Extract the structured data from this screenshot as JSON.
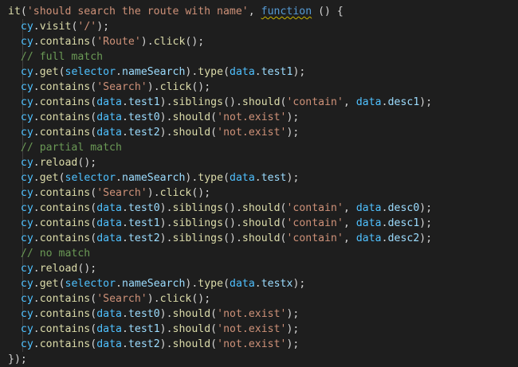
{
  "editor": {
    "theme": {
      "background": "#1e1e1e",
      "plain": "#d4d4d4",
      "variable": "#4fc1ff",
      "property": "#9cdcfe",
      "function": "#dcdcaa",
      "string": "#ce9178",
      "keyword": "#569cd6",
      "comment": "#6a9955",
      "warning_squiggle": "#c8b400"
    },
    "lines": [
      {
        "guide": false,
        "tokens": [
          [
            "fn",
            "it"
          ],
          [
            "plain",
            "("
          ],
          [
            "str",
            "'should search the route with name'"
          ],
          [
            "plain",
            ", "
          ],
          [
            "kw",
            "function",
            true
          ],
          [
            "plain",
            " () {"
          ]
        ]
      },
      {
        "guide": true,
        "tokens": [
          [
            "plain",
            "  "
          ],
          [
            "var",
            "cy"
          ],
          [
            "plain",
            "."
          ],
          [
            "fn",
            "visit"
          ],
          [
            "plain",
            "("
          ],
          [
            "str",
            "'/'"
          ],
          [
            "plain",
            ");"
          ]
        ]
      },
      {
        "guide": true,
        "tokens": [
          [
            "plain",
            "  "
          ],
          [
            "var",
            "cy"
          ],
          [
            "plain",
            "."
          ],
          [
            "fn",
            "contains"
          ],
          [
            "plain",
            "("
          ],
          [
            "str",
            "'Route'"
          ],
          [
            "plain",
            ")."
          ],
          [
            "fn",
            "click"
          ],
          [
            "plain",
            "();"
          ]
        ]
      },
      {
        "guide": true,
        "tokens": [
          [
            "plain",
            "  "
          ],
          [
            "com",
            "// full match"
          ]
        ]
      },
      {
        "guide": true,
        "tokens": [
          [
            "plain",
            "  "
          ],
          [
            "var",
            "cy"
          ],
          [
            "plain",
            "."
          ],
          [
            "fn",
            "get"
          ],
          [
            "plain",
            "("
          ],
          [
            "var",
            "selector"
          ],
          [
            "plain",
            "."
          ],
          [
            "prop",
            "nameSearch"
          ],
          [
            "plain",
            ")."
          ],
          [
            "fn",
            "type"
          ],
          [
            "plain",
            "("
          ],
          [
            "var",
            "data"
          ],
          [
            "plain",
            "."
          ],
          [
            "prop",
            "test1"
          ],
          [
            "plain",
            ");"
          ]
        ]
      },
      {
        "guide": true,
        "tokens": [
          [
            "plain",
            "  "
          ],
          [
            "var",
            "cy"
          ],
          [
            "plain",
            "."
          ],
          [
            "fn",
            "contains"
          ],
          [
            "plain",
            "("
          ],
          [
            "str",
            "'Search'"
          ],
          [
            "plain",
            ")."
          ],
          [
            "fn",
            "click"
          ],
          [
            "plain",
            "();"
          ]
        ]
      },
      {
        "guide": true,
        "tokens": [
          [
            "plain",
            "  "
          ],
          [
            "var",
            "cy"
          ],
          [
            "plain",
            "."
          ],
          [
            "fn",
            "contains"
          ],
          [
            "plain",
            "("
          ],
          [
            "var",
            "data"
          ],
          [
            "plain",
            "."
          ],
          [
            "prop",
            "test1"
          ],
          [
            "plain",
            ")."
          ],
          [
            "fn",
            "siblings"
          ],
          [
            "plain",
            "()."
          ],
          [
            "fn",
            "should"
          ],
          [
            "plain",
            "("
          ],
          [
            "str",
            "'contain'"
          ],
          [
            "plain",
            ", "
          ],
          [
            "var",
            "data"
          ],
          [
            "plain",
            "."
          ],
          [
            "prop",
            "desc1"
          ],
          [
            "plain",
            ");"
          ]
        ]
      },
      {
        "guide": true,
        "tokens": [
          [
            "plain",
            "  "
          ],
          [
            "var",
            "cy"
          ],
          [
            "plain",
            "."
          ],
          [
            "fn",
            "contains"
          ],
          [
            "plain",
            "("
          ],
          [
            "var",
            "data"
          ],
          [
            "plain",
            "."
          ],
          [
            "prop",
            "test0"
          ],
          [
            "plain",
            ")."
          ],
          [
            "fn",
            "should"
          ],
          [
            "plain",
            "("
          ],
          [
            "str",
            "'not.exist'"
          ],
          [
            "plain",
            ");"
          ]
        ]
      },
      {
        "guide": true,
        "tokens": [
          [
            "plain",
            "  "
          ],
          [
            "var",
            "cy"
          ],
          [
            "plain",
            "."
          ],
          [
            "fn",
            "contains"
          ],
          [
            "plain",
            "("
          ],
          [
            "var",
            "data"
          ],
          [
            "plain",
            "."
          ],
          [
            "prop",
            "test2"
          ],
          [
            "plain",
            ")."
          ],
          [
            "fn",
            "should"
          ],
          [
            "plain",
            "("
          ],
          [
            "str",
            "'not.exist'"
          ],
          [
            "plain",
            ");"
          ]
        ]
      },
      {
        "guide": true,
        "tokens": [
          [
            "plain",
            "  "
          ],
          [
            "com",
            "// partial match"
          ]
        ]
      },
      {
        "guide": true,
        "tokens": [
          [
            "plain",
            "  "
          ],
          [
            "var",
            "cy"
          ],
          [
            "plain",
            "."
          ],
          [
            "fn",
            "reload"
          ],
          [
            "plain",
            "();"
          ]
        ]
      },
      {
        "guide": true,
        "tokens": [
          [
            "plain",
            "  "
          ],
          [
            "var",
            "cy"
          ],
          [
            "plain",
            "."
          ],
          [
            "fn",
            "get"
          ],
          [
            "plain",
            "("
          ],
          [
            "var",
            "selector"
          ],
          [
            "plain",
            "."
          ],
          [
            "prop",
            "nameSearch"
          ],
          [
            "plain",
            ")."
          ],
          [
            "fn",
            "type"
          ],
          [
            "plain",
            "("
          ],
          [
            "var",
            "data"
          ],
          [
            "plain",
            "."
          ],
          [
            "prop",
            "test"
          ],
          [
            "plain",
            ");"
          ]
        ]
      },
      {
        "guide": true,
        "tokens": [
          [
            "plain",
            "  "
          ],
          [
            "var",
            "cy"
          ],
          [
            "plain",
            "."
          ],
          [
            "fn",
            "contains"
          ],
          [
            "plain",
            "("
          ],
          [
            "str",
            "'Search'"
          ],
          [
            "plain",
            ")."
          ],
          [
            "fn",
            "click"
          ],
          [
            "plain",
            "();"
          ]
        ]
      },
      {
        "guide": true,
        "tokens": [
          [
            "plain",
            "  "
          ],
          [
            "var",
            "cy"
          ],
          [
            "plain",
            "."
          ],
          [
            "fn",
            "contains"
          ],
          [
            "plain",
            "("
          ],
          [
            "var",
            "data"
          ],
          [
            "plain",
            "."
          ],
          [
            "prop",
            "test0"
          ],
          [
            "plain",
            ")."
          ],
          [
            "fn",
            "siblings"
          ],
          [
            "plain",
            "()."
          ],
          [
            "fn",
            "should"
          ],
          [
            "plain",
            "("
          ],
          [
            "str",
            "'contain'"
          ],
          [
            "plain",
            ", "
          ],
          [
            "var",
            "data"
          ],
          [
            "plain",
            "."
          ],
          [
            "prop",
            "desc0"
          ],
          [
            "plain",
            ");"
          ]
        ]
      },
      {
        "guide": true,
        "tokens": [
          [
            "plain",
            "  "
          ],
          [
            "var",
            "cy"
          ],
          [
            "plain",
            "."
          ],
          [
            "fn",
            "contains"
          ],
          [
            "plain",
            "("
          ],
          [
            "var",
            "data"
          ],
          [
            "plain",
            "."
          ],
          [
            "prop",
            "test1"
          ],
          [
            "plain",
            ")."
          ],
          [
            "fn",
            "siblings"
          ],
          [
            "plain",
            "()."
          ],
          [
            "fn",
            "should"
          ],
          [
            "plain",
            "("
          ],
          [
            "str",
            "'contain'"
          ],
          [
            "plain",
            ", "
          ],
          [
            "var",
            "data"
          ],
          [
            "plain",
            "."
          ],
          [
            "prop",
            "desc1"
          ],
          [
            "plain",
            ");"
          ]
        ]
      },
      {
        "guide": true,
        "tokens": [
          [
            "plain",
            "  "
          ],
          [
            "var",
            "cy"
          ],
          [
            "plain",
            "."
          ],
          [
            "fn",
            "contains"
          ],
          [
            "plain",
            "("
          ],
          [
            "var",
            "data"
          ],
          [
            "plain",
            "."
          ],
          [
            "prop",
            "test2"
          ],
          [
            "plain",
            ")."
          ],
          [
            "fn",
            "siblings"
          ],
          [
            "plain",
            "()."
          ],
          [
            "fn",
            "should"
          ],
          [
            "plain",
            "("
          ],
          [
            "str",
            "'contain'"
          ],
          [
            "plain",
            ", "
          ],
          [
            "var",
            "data"
          ],
          [
            "plain",
            "."
          ],
          [
            "prop",
            "desc2"
          ],
          [
            "plain",
            ");"
          ]
        ]
      },
      {
        "guide": true,
        "tokens": [
          [
            "plain",
            "  "
          ],
          [
            "com",
            "// no match"
          ]
        ]
      },
      {
        "guide": true,
        "tokens": [
          [
            "plain",
            "  "
          ],
          [
            "var",
            "cy"
          ],
          [
            "plain",
            "."
          ],
          [
            "fn",
            "reload"
          ],
          [
            "plain",
            "();"
          ]
        ]
      },
      {
        "guide": true,
        "tokens": [
          [
            "plain",
            "  "
          ],
          [
            "var",
            "cy"
          ],
          [
            "plain",
            "."
          ],
          [
            "fn",
            "get"
          ],
          [
            "plain",
            "("
          ],
          [
            "var",
            "selector"
          ],
          [
            "plain",
            "."
          ],
          [
            "prop",
            "nameSearch"
          ],
          [
            "plain",
            ")."
          ],
          [
            "fn",
            "type"
          ],
          [
            "plain",
            "("
          ],
          [
            "var",
            "data"
          ],
          [
            "plain",
            "."
          ],
          [
            "prop",
            "testx"
          ],
          [
            "plain",
            ");"
          ]
        ]
      },
      {
        "guide": true,
        "tokens": [
          [
            "plain",
            "  "
          ],
          [
            "var",
            "cy"
          ],
          [
            "plain",
            "."
          ],
          [
            "fn",
            "contains"
          ],
          [
            "plain",
            "("
          ],
          [
            "str",
            "'Search'"
          ],
          [
            "plain",
            ")."
          ],
          [
            "fn",
            "click"
          ],
          [
            "plain",
            "();"
          ]
        ]
      },
      {
        "guide": true,
        "tokens": [
          [
            "plain",
            "  "
          ],
          [
            "var",
            "cy"
          ],
          [
            "plain",
            "."
          ],
          [
            "fn",
            "contains"
          ],
          [
            "plain",
            "("
          ],
          [
            "var",
            "data"
          ],
          [
            "plain",
            "."
          ],
          [
            "prop",
            "test0"
          ],
          [
            "plain",
            ")."
          ],
          [
            "fn",
            "should"
          ],
          [
            "plain",
            "("
          ],
          [
            "str",
            "'not.exist'"
          ],
          [
            "plain",
            ");"
          ]
        ]
      },
      {
        "guide": true,
        "tokens": [
          [
            "plain",
            "  "
          ],
          [
            "var",
            "cy"
          ],
          [
            "plain",
            "."
          ],
          [
            "fn",
            "contains"
          ],
          [
            "plain",
            "("
          ],
          [
            "var",
            "data"
          ],
          [
            "plain",
            "."
          ],
          [
            "prop",
            "test1"
          ],
          [
            "plain",
            ")."
          ],
          [
            "fn",
            "should"
          ],
          [
            "plain",
            "("
          ],
          [
            "str",
            "'not.exist'"
          ],
          [
            "plain",
            ");"
          ]
        ]
      },
      {
        "guide": true,
        "tokens": [
          [
            "plain",
            "  "
          ],
          [
            "var",
            "cy"
          ],
          [
            "plain",
            "."
          ],
          [
            "fn",
            "contains"
          ],
          [
            "plain",
            "("
          ],
          [
            "var",
            "data"
          ],
          [
            "plain",
            "."
          ],
          [
            "prop",
            "test2"
          ],
          [
            "plain",
            ")."
          ],
          [
            "fn",
            "should"
          ],
          [
            "plain",
            "("
          ],
          [
            "str",
            "'not.exist'"
          ],
          [
            "plain",
            ");"
          ]
        ]
      },
      {
        "guide": false,
        "tokens": [
          [
            "plain",
            "});"
          ]
        ]
      }
    ]
  }
}
